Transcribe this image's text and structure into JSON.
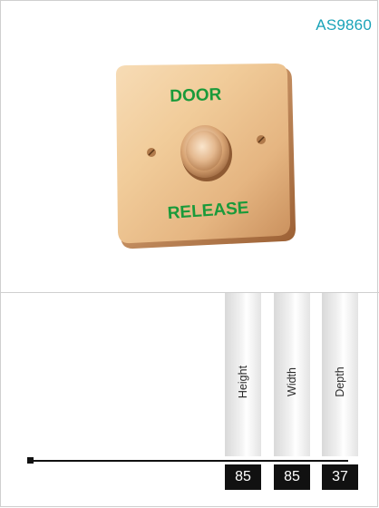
{
  "product": {
    "code": "AS9860",
    "plate_text_top": "DOOR",
    "plate_text_bottom": "RELEASE"
  },
  "dimensions": [
    {
      "label": "Height",
      "value": "85"
    },
    {
      "label": "Width",
      "value": "85"
    },
    {
      "label": "Depth",
      "value": "37"
    }
  ],
  "colors": {
    "code_accent": "#1aa3b8",
    "plate_text": "#1a9a3a",
    "value_box": "#111111"
  }
}
